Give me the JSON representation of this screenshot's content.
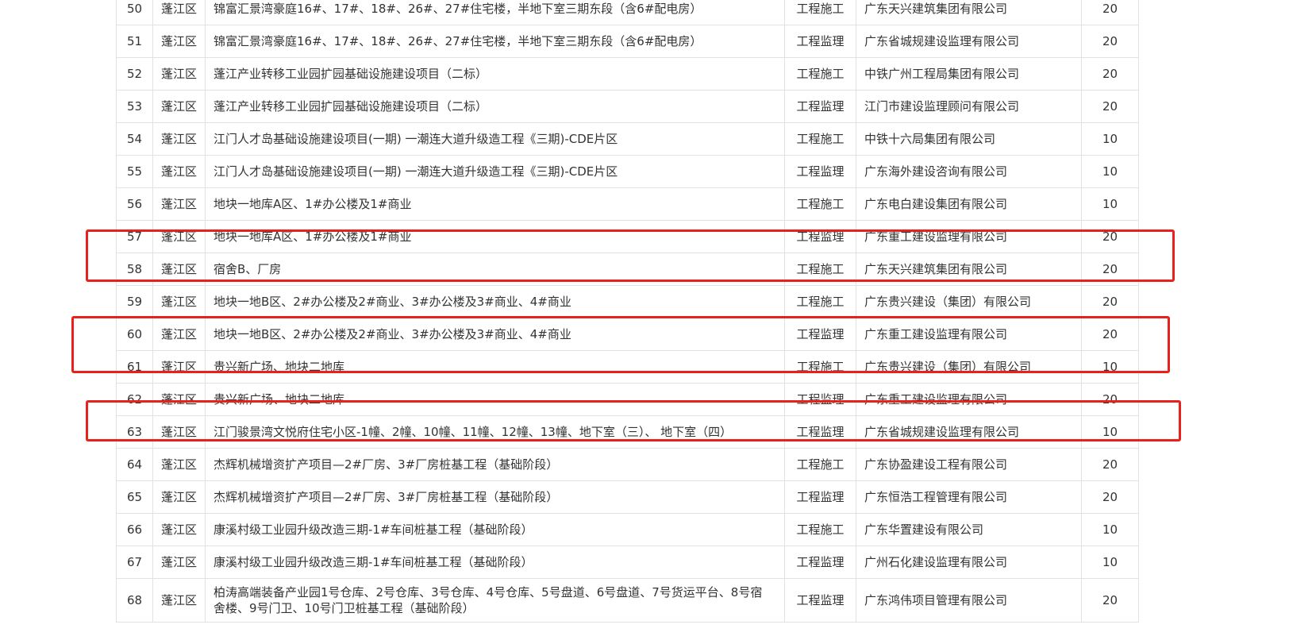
{
  "colors": {
    "highlight": "#e8211c",
    "grid": "#e2e2e2",
    "text": "#333333"
  },
  "rows": [
    {
      "no": "50",
      "district": "蓬江区",
      "project": "锦富汇景湾豪庭16#、17#、18#、26#、27#住宅楼，半地下室三期东段（含6#配电房）",
      "type": "工程施工",
      "company": "广东天兴建筑集团有限公司",
      "points": "20"
    },
    {
      "no": "51",
      "district": "蓬江区",
      "project": "锦富汇景湾豪庭16#、17#、18#、26#、27#住宅楼，半地下室三期东段（含6#配电房）",
      "type": "工程监理",
      "company": "广东省城规建设监理有限公司",
      "points": "20"
    },
    {
      "no": "52",
      "district": "蓬江区",
      "project": "蓬江产业转移工业园扩园基础设施建设项目（二标）",
      "type": "工程施工",
      "company": "中铁广州工程局集团有限公司",
      "points": "20"
    },
    {
      "no": "53",
      "district": "蓬江区",
      "project": "蓬江产业转移工业园扩园基础设施建设项目（二标）",
      "type": "工程监理",
      "company": "江门市建设监理顾问有限公司",
      "points": "20"
    },
    {
      "no": "54",
      "district": "蓬江区",
      "project": "江门人才岛基础设施建设项目(一期) 一潮连大道升级造工程《三期)-CDE片区",
      "type": "工程施工",
      "company": "中铁十六局集团有限公司",
      "points": "10"
    },
    {
      "no": "55",
      "district": "蓬江区",
      "project": "江门人才岛基础设施建设项目(一期) 一潮连大道升级造工程《三期)-CDE片区",
      "type": "工程监理",
      "company": "广东海外建设咨询有限公司",
      "points": "10"
    },
    {
      "no": "56",
      "district": "蓬江区",
      "project": "地块一地库A区、1#办公楼及1#商业",
      "type": "工程施工",
      "company": "广东电白建设集团有限公司",
      "points": "10"
    },
    {
      "no": "57",
      "district": "蓬江区",
      "project": "地块一地库A区、1#办公楼及1#商业",
      "type": "工程监理",
      "company": "广东重工建设监理有限公司",
      "points": "20"
    },
    {
      "no": "58",
      "district": "蓬江区",
      "project": "宿舍B、厂房",
      "type": "工程施工",
      "company": "广东天兴建筑集团有限公司",
      "points": "20"
    },
    {
      "no": "59",
      "district": "蓬江区",
      "project": "地块一地B区、2#办公楼及2#商业、3#办公楼及3#商业、4#商业",
      "type": "工程施工",
      "company": "广东贵兴建设（集团）有限公司",
      "points": "20"
    },
    {
      "no": "60",
      "district": "蓬江区",
      "project": "地块一地B区、2#办公楼及2#商业、3#办公楼及3#商业、4#商业",
      "type": "工程监理",
      "company": "广东重工建设监理有限公司",
      "points": "20"
    },
    {
      "no": "61",
      "district": "蓬江区",
      "project": "贵兴新广场、地块二地库",
      "type": "工程施工",
      "company": "广东贵兴建设（集团）有限公司",
      "points": "10"
    },
    {
      "no": "62",
      "district": "蓬江区",
      "project": "贵兴新广场、地块二地库",
      "type": "工程监理",
      "company": "广东重工建设监理有限公司",
      "points": "20"
    },
    {
      "no": "63",
      "district": "蓬江区",
      "project": "江门骏景湾文悦府住宅小区-1幢、2幢、10幢、11幢、12幢、13幢、地下室（三）、 地下室（四）",
      "type": "工程监理",
      "company": "广东省城规建设监理有限公司",
      "points": "10"
    },
    {
      "no": "64",
      "district": "蓬江区",
      "project": "杰辉机械增资扩产项目—2#厂房、3#厂房桩基工程（基础阶段）",
      "type": "工程施工",
      "company": "广东协盈建设工程有限公司",
      "points": "20"
    },
    {
      "no": "65",
      "district": "蓬江区",
      "project": "杰辉机械增资扩产项目—2#厂房、3#厂房桩基工程（基础阶段）",
      "type": "工程监理",
      "company": "广东恒浩工程管理有限公司",
      "points": "20"
    },
    {
      "no": "66",
      "district": "蓬江区",
      "project": "康溪村级工业园升级改造三期-1#车间桩基工程（基础阶段）",
      "type": "工程施工",
      "company": "广东华置建设有限公司",
      "points": "10"
    },
    {
      "no": "67",
      "district": "蓬江区",
      "project": "康溪村级工业园升级改造三期-1#车间桩基工程（基础阶段）",
      "type": "工程监理",
      "company": "广州石化建设监理有限公司",
      "points": "10"
    },
    {
      "no": "68",
      "district": "蓬江区",
      "project": "柏涛高端装备产业园1号仓库、2号仓库、3号仓库、4号仓库、5号盘道、6号盘道、7号货运平台、8号宿 舍楼、9号门卫、10号门卫桩基工程（基础阶段）",
      "type": "工程监理",
      "company": "广东鸿伟项目管理有限公司",
      "points": "20"
    }
  ]
}
